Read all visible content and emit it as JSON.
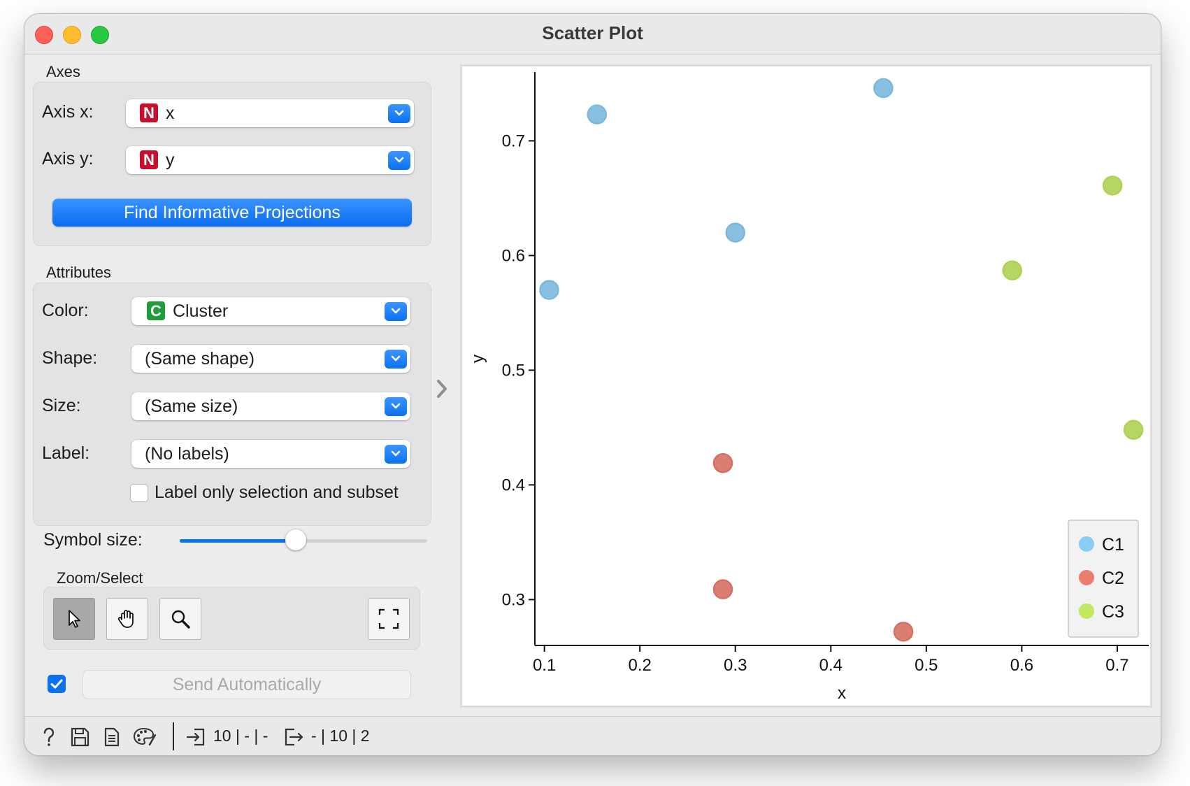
{
  "window": {
    "title": "Scatter Plot"
  },
  "axes": {
    "section_label": "Axes",
    "x_label": "Axis x:",
    "x_value": "x",
    "x_type_badge": "N",
    "y_label": "Axis y:",
    "y_value": "y",
    "y_type_badge": "N",
    "find_button": "Find Informative Projections"
  },
  "attributes": {
    "section_label": "Attributes",
    "color_label": "Color:",
    "color_value": "Cluster",
    "color_type_badge": "C",
    "shape_label": "Shape:",
    "shape_value": "(Same shape)",
    "size_label": "Size:",
    "size_value": "(Same size)",
    "label_label": "Label:",
    "label_value": "(No labels)",
    "label_only_checkbox": "Label only selection and subset",
    "label_only_checked": false
  },
  "symbol_size": {
    "label": "Symbol size:",
    "value_fraction": 0.47
  },
  "zoom_select": {
    "section_label": "Zoom/Select",
    "tools": [
      "select-pointer-icon",
      "pan-hand-icon",
      "zoom-magnifier-icon",
      "reset-zoom-icon"
    ],
    "active_tool": "select-pointer-icon"
  },
  "send": {
    "auto_checked": true,
    "button_label": "Send Automatically"
  },
  "status": {
    "icons": [
      "help-icon",
      "save-icon",
      "report-icon",
      "palette-icon"
    ],
    "input_summary": "10 | - | -",
    "output_summary": "- | 10 | 2"
  },
  "colors": {
    "C1": "#87cdf5",
    "C2": "#ec7d6e",
    "C3": "#c2e85e",
    "accent": "#0a72f0"
  },
  "chart_data": {
    "type": "scatter",
    "xlabel": "x",
    "ylabel": "y",
    "xlim": [
      0.09,
      0.733
    ],
    "ylim": [
      0.26,
      0.76
    ],
    "xticks": [
      0.1,
      0.2,
      0.3,
      0.4,
      0.5,
      0.6,
      0.7
    ],
    "yticks": [
      0.3,
      0.4,
      0.5,
      0.6,
      0.7
    ],
    "legend_position": "bottom-right",
    "series": [
      {
        "name": "C1",
        "color": "#87cdf5",
        "x": [
          0.105,
          0.155,
          0.3,
          0.455
        ],
        "y": [
          0.57,
          0.723,
          0.62,
          0.746
        ]
      },
      {
        "name": "C2",
        "color": "#ec7d6e",
        "x": [
          0.287,
          0.287,
          0.476
        ],
        "y": [
          0.419,
          0.309,
          0.272
        ]
      },
      {
        "name": "C3",
        "color": "#c2e85e",
        "x": [
          0.59,
          0.695,
          0.717
        ],
        "y": [
          0.587,
          0.661,
          0.448
        ]
      }
    ]
  }
}
